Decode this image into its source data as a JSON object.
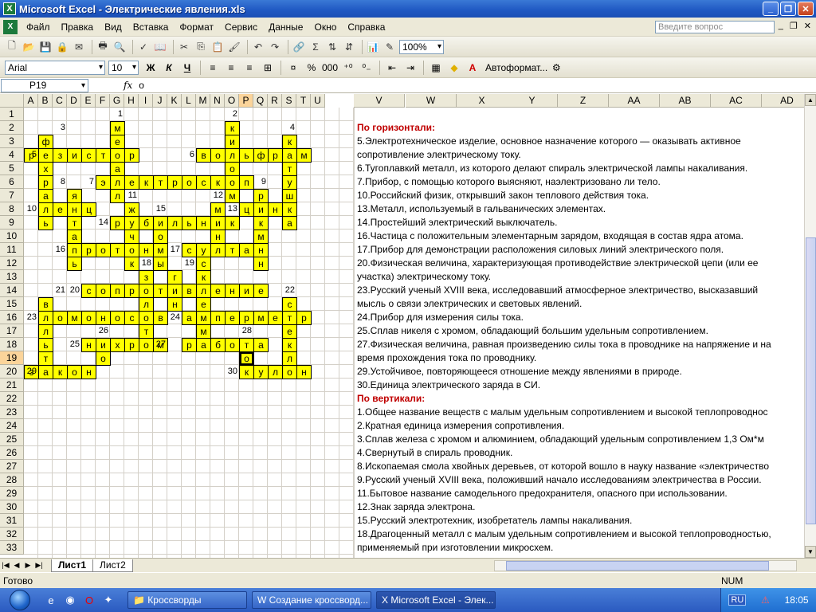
{
  "window": {
    "title": "Microsoft Excel - Электрические явления.xls",
    "app_icon": "X"
  },
  "menu": {
    "items": [
      "Файл",
      "Правка",
      "Вид",
      "Вставка",
      "Формат",
      "Сервис",
      "Данные",
      "Окно",
      "Справка"
    ],
    "ask_placeholder": "Введите вопрос"
  },
  "toolbar": {
    "zoom": "100%",
    "font": "Arial",
    "size": "10",
    "autoformat": "Автоформат..."
  },
  "formula": {
    "cell": "P19",
    "fx": "fx",
    "value": "о"
  },
  "columns": [
    "A",
    "B",
    "C",
    "D",
    "E",
    "F",
    "G",
    "H",
    "I",
    "J",
    "K",
    "L",
    "M",
    "N",
    "O",
    "P",
    "Q",
    "R",
    "S",
    "T",
    "U"
  ],
  "columns_wide": [
    "V",
    "W",
    "X",
    "Y",
    "Z",
    "AA",
    "AB",
    "AC",
    "AD"
  ],
  "rows": [
    "1",
    "2",
    "3",
    "4",
    "5",
    "6",
    "7",
    "8",
    "9",
    "10",
    "11",
    "12",
    "13",
    "14",
    "15",
    "16",
    "17",
    "18",
    "19",
    "20",
    "21",
    "22",
    "23",
    "24",
    "25",
    "26",
    "27",
    "28",
    "29",
    "30",
    "31",
    "32",
    "33"
  ],
  "crossword": {
    "numbers": [
      {
        "t": "1",
        "r": 1,
        "c": 7
      },
      {
        "t": "2",
        "r": 1,
        "c": 15
      },
      {
        "t": "3",
        "r": 2,
        "c": 3
      },
      {
        "t": "4",
        "r": 2,
        "c": 19
      },
      {
        "t": "5",
        "r": 4,
        "c": 1
      },
      {
        "t": "6",
        "r": 4,
        "c": 12
      },
      {
        "t": "8",
        "r": 6,
        "c": 3
      },
      {
        "t": "7",
        "r": 6,
        "c": 5
      },
      {
        "t": "9",
        "r": 6,
        "c": 17
      },
      {
        "t": "11",
        "r": 7,
        "c": 8
      },
      {
        "t": "12",
        "r": 7,
        "c": 14
      },
      {
        "t": "10",
        "r": 8,
        "c": 1
      },
      {
        "t": "15",
        "r": 8,
        "c": 10
      },
      {
        "t": "13",
        "r": 8,
        "c": 15
      },
      {
        "t": "14",
        "r": 9,
        "c": 6
      },
      {
        "t": "16",
        "r": 11,
        "c": 3
      },
      {
        "t": "17",
        "r": 11,
        "c": 11
      },
      {
        "t": "18",
        "r": 12,
        "c": 9
      },
      {
        "t": "19",
        "r": 12,
        "c": 12
      },
      {
        "t": "21",
        "r": 14,
        "c": 3
      },
      {
        "t": "20",
        "r": 14,
        "c": 4
      },
      {
        "t": "22",
        "r": 14,
        "c": 19
      },
      {
        "t": "23",
        "r": 16,
        "c": 1
      },
      {
        "t": "24",
        "r": 16,
        "c": 11
      },
      {
        "t": "26",
        "r": 17,
        "c": 6
      },
      {
        "t": "28",
        "r": 17,
        "c": 16
      },
      {
        "t": "25",
        "r": 18,
        "c": 4
      },
      {
        "t": "27",
        "r": 18,
        "c": 10
      },
      {
        "t": "29",
        "r": 20,
        "c": 1
      },
      {
        "t": "30",
        "r": 20,
        "c": 15
      }
    ],
    "cells": [
      {
        "r": 2,
        "c": 7,
        "ch": "м"
      },
      {
        "r": 2,
        "c": 15,
        "ch": "к"
      },
      {
        "r": 3,
        "c": 2,
        "ch": "ф"
      },
      {
        "r": 3,
        "c": 7,
        "ch": "е"
      },
      {
        "r": 3,
        "c": 15,
        "ch": "и"
      },
      {
        "r": 3,
        "c": 19,
        "ch": "к"
      },
      {
        "r": 4,
        "c": 1,
        "ch": "р"
      },
      {
        "r": 4,
        "c": 2,
        "ch": "е"
      },
      {
        "r": 4,
        "c": 3,
        "ch": "з"
      },
      {
        "r": 4,
        "c": 4,
        "ch": "и"
      },
      {
        "r": 4,
        "c": 5,
        "ch": "с"
      },
      {
        "r": 4,
        "c": 6,
        "ch": "т"
      },
      {
        "r": 4,
        "c": 7,
        "ch": "о"
      },
      {
        "r": 4,
        "c": 8,
        "ch": "р"
      },
      {
        "r": 4,
        "c": 13,
        "ch": "в"
      },
      {
        "r": 4,
        "c": 14,
        "ch": "о"
      },
      {
        "r": 4,
        "c": 15,
        "ch": "л"
      },
      {
        "r": 4,
        "c": 16,
        "ch": "ь"
      },
      {
        "r": 4,
        "c": 17,
        "ch": "ф"
      },
      {
        "r": 4,
        "c": 18,
        "ch": "р"
      },
      {
        "r": 4,
        "c": 19,
        "ch": "а"
      },
      {
        "r": 4,
        "c": 20,
        "ch": "м"
      },
      {
        "r": 5,
        "c": 2,
        "ch": "х"
      },
      {
        "r": 5,
        "c": 7,
        "ch": "а"
      },
      {
        "r": 5,
        "c": 15,
        "ch": "о"
      },
      {
        "r": 5,
        "c": 19,
        "ch": "т"
      },
      {
        "r": 6,
        "c": 2,
        "ch": "р"
      },
      {
        "r": 6,
        "c": 6,
        "ch": "э"
      },
      {
        "r": 6,
        "c": 7,
        "ch": "л"
      },
      {
        "r": 6,
        "c": 8,
        "ch": "е"
      },
      {
        "r": 6,
        "c": 9,
        "ch": "к"
      },
      {
        "r": 6,
        "c": 10,
        "ch": "т"
      },
      {
        "r": 6,
        "c": 11,
        "ch": "р"
      },
      {
        "r": 6,
        "c": 12,
        "ch": "о"
      },
      {
        "r": 6,
        "c": 13,
        "ch": "с"
      },
      {
        "r": 6,
        "c": 14,
        "ch": "к"
      },
      {
        "r": 6,
        "c": 15,
        "ch": "о"
      },
      {
        "r": 6,
        "c": 16,
        "ch": "п"
      },
      {
        "r": 6,
        "c": 19,
        "ch": "у"
      },
      {
        "r": 7,
        "c": 2,
        "ch": "а"
      },
      {
        "r": 7,
        "c": 4,
        "ch": "я"
      },
      {
        "r": 7,
        "c": 7,
        "ch": "л"
      },
      {
        "r": 7,
        "c": 15,
        "ch": "м"
      },
      {
        "r": 7,
        "c": 17,
        "ch": "р"
      },
      {
        "r": 7,
        "c": 19,
        "ch": "ш"
      },
      {
        "r": 8,
        "c": 2,
        "ch": "л"
      },
      {
        "r": 8,
        "c": 3,
        "ch": "е"
      },
      {
        "r": 8,
        "c": 4,
        "ch": "н"
      },
      {
        "r": 8,
        "c": 5,
        "ch": "ц"
      },
      {
        "r": 8,
        "c": 8,
        "ch": "ж"
      },
      {
        "r": 8,
        "c": 14,
        "ch": "м"
      },
      {
        "r": 8,
        "c": 16,
        "ch": "ц"
      },
      {
        "r": 8,
        "c": 17,
        "ch": "и"
      },
      {
        "r": 8,
        "c": 18,
        "ch": "н"
      },
      {
        "r": 8,
        "c": 19,
        "ch": "к"
      },
      {
        "r": 9,
        "c": 2,
        "ch": "ь"
      },
      {
        "r": 9,
        "c": 4,
        "ch": "т"
      },
      {
        "r": 9,
        "c": 7,
        "ch": "р"
      },
      {
        "r": 9,
        "c": 8,
        "ch": "у"
      },
      {
        "r": 9,
        "c": 9,
        "ch": "б"
      },
      {
        "r": 9,
        "c": 10,
        "ch": "и"
      },
      {
        "r": 9,
        "c": 11,
        "ch": "л"
      },
      {
        "r": 9,
        "c": 12,
        "ch": "ь"
      },
      {
        "r": 9,
        "c": 13,
        "ch": "н"
      },
      {
        "r": 9,
        "c": 14,
        "ch": "и"
      },
      {
        "r": 9,
        "c": 15,
        "ch": "к"
      },
      {
        "r": 9,
        "c": 17,
        "ch": "к"
      },
      {
        "r": 9,
        "c": 19,
        "ch": "а"
      },
      {
        "r": 10,
        "c": 4,
        "ch": "а"
      },
      {
        "r": 10,
        "c": 8,
        "ch": "ч"
      },
      {
        "r": 10,
        "c": 10,
        "ch": "о"
      },
      {
        "r": 10,
        "c": 14,
        "ch": "н"
      },
      {
        "r": 10,
        "c": 17,
        "ch": "м"
      },
      {
        "r": 11,
        "c": 4,
        "ch": "п"
      },
      {
        "r": 11,
        "c": 5,
        "ch": "р"
      },
      {
        "r": 11,
        "c": 6,
        "ch": "о"
      },
      {
        "r": 11,
        "c": 7,
        "ch": "т"
      },
      {
        "r": 11,
        "c": 8,
        "ch": "о"
      },
      {
        "r": 11,
        "c": 9,
        "ch": "н"
      },
      {
        "r": 11,
        "c": 10,
        "ch": "м"
      },
      {
        "r": 11,
        "c": 12,
        "ch": "с"
      },
      {
        "r": 11,
        "c": 13,
        "ch": "у"
      },
      {
        "r": 11,
        "c": 14,
        "ch": "л"
      },
      {
        "r": 11,
        "c": 15,
        "ch": "т"
      },
      {
        "r": 11,
        "c": 16,
        "ch": "а"
      },
      {
        "r": 11,
        "c": 17,
        "ch": "н"
      },
      {
        "r": 12,
        "c": 4,
        "ch": "ь"
      },
      {
        "r": 12,
        "c": 8,
        "ch": "к"
      },
      {
        "r": 12,
        "c": 10,
        "ch": "ы"
      },
      {
        "r": 12,
        "c": 13,
        "ch": "с"
      },
      {
        "r": 12,
        "c": 17,
        "ch": "н"
      },
      {
        "r": 13,
        "c": 9,
        "ch": "з"
      },
      {
        "r": 13,
        "c": 11,
        "ch": "г"
      },
      {
        "r": 13,
        "c": 13,
        "ch": "к"
      },
      {
        "r": 14,
        "c": 5,
        "ch": "с"
      },
      {
        "r": 14,
        "c": 6,
        "ch": "о"
      },
      {
        "r": 14,
        "c": 7,
        "ch": "п"
      },
      {
        "r": 14,
        "c": 8,
        "ch": "р"
      },
      {
        "r": 14,
        "c": 9,
        "ch": "о"
      },
      {
        "r": 14,
        "c": 10,
        "ch": "т"
      },
      {
        "r": 14,
        "c": 11,
        "ch": "и"
      },
      {
        "r": 14,
        "c": 12,
        "ch": "в"
      },
      {
        "r": 14,
        "c": 13,
        "ch": "л"
      },
      {
        "r": 14,
        "c": 14,
        "ch": "е"
      },
      {
        "r": 14,
        "c": 15,
        "ch": "н"
      },
      {
        "r": 14,
        "c": 16,
        "ch": "и"
      },
      {
        "r": 14,
        "c": 17,
        "ch": "е"
      },
      {
        "r": 15,
        "c": 2,
        "ch": "в"
      },
      {
        "r": 15,
        "c": 9,
        "ch": "л"
      },
      {
        "r": 15,
        "c": 11,
        "ch": "н"
      },
      {
        "r": 15,
        "c": 13,
        "ch": "е"
      },
      {
        "r": 15,
        "c": 19,
        "ch": "с"
      },
      {
        "r": 16,
        "c": 2,
        "ch": "л"
      },
      {
        "r": 16,
        "c": 3,
        "ch": "о"
      },
      {
        "r": 16,
        "c": 4,
        "ch": "м"
      },
      {
        "r": 16,
        "c": 5,
        "ch": "о"
      },
      {
        "r": 16,
        "c": 6,
        "ch": "н"
      },
      {
        "r": 16,
        "c": 7,
        "ch": "о"
      },
      {
        "r": 16,
        "c": 8,
        "ch": "с"
      },
      {
        "r": 16,
        "c": 9,
        "ch": "о"
      },
      {
        "r": 16,
        "c": 10,
        "ch": "в"
      },
      {
        "r": 16,
        "c": 12,
        "ch": "а"
      },
      {
        "r": 16,
        "c": 13,
        "ch": "м"
      },
      {
        "r": 16,
        "c": 14,
        "ch": "п"
      },
      {
        "r": 16,
        "c": 15,
        "ch": "е"
      },
      {
        "r": 16,
        "c": 16,
        "ch": "р"
      },
      {
        "r": 16,
        "c": 17,
        "ch": "м"
      },
      {
        "r": 16,
        "c": 18,
        "ch": "е"
      },
      {
        "r": 16,
        "c": 19,
        "ch": "т"
      },
      {
        "r": 16,
        "c": 20,
        "ch": "р"
      },
      {
        "r": 17,
        "c": 2,
        "ch": "л"
      },
      {
        "r": 17,
        "c": 9,
        "ch": "т"
      },
      {
        "r": 17,
        "c": 13,
        "ch": "м"
      },
      {
        "r": 17,
        "c": 19,
        "ch": "е"
      },
      {
        "r": 18,
        "c": 2,
        "ch": "ь"
      },
      {
        "r": 18,
        "c": 5,
        "ch": "н"
      },
      {
        "r": 18,
        "c": 6,
        "ch": "и"
      },
      {
        "r": 18,
        "c": 7,
        "ch": "х"
      },
      {
        "r": 18,
        "c": 8,
        "ch": "р"
      },
      {
        "r": 18,
        "c": 9,
        "ch": "о"
      },
      {
        "r": 18,
        "c": 10,
        "ch": "м"
      },
      {
        "r": 18,
        "c": 12,
        "ch": "р"
      },
      {
        "r": 18,
        "c": 13,
        "ch": "а"
      },
      {
        "r": 18,
        "c": 14,
        "ch": "б"
      },
      {
        "r": 18,
        "c": 15,
        "ch": "о"
      },
      {
        "r": 18,
        "c": 16,
        "ch": "т"
      },
      {
        "r": 18,
        "c": 17,
        "ch": "а"
      },
      {
        "r": 18,
        "c": 19,
        "ch": "к"
      },
      {
        "r": 19,
        "c": 2,
        "ch": "т"
      },
      {
        "r": 19,
        "c": 6,
        "ch": "о"
      },
      {
        "r": 19,
        "c": 16,
        "ch": "о",
        "active": true
      },
      {
        "r": 19,
        "c": 19,
        "ch": "л"
      },
      {
        "r": 20,
        "c": 1,
        "ch": "з"
      },
      {
        "r": 20,
        "c": 2,
        "ch": "а"
      },
      {
        "r": 20,
        "c": 3,
        "ch": "к"
      },
      {
        "r": 20,
        "c": 4,
        "ch": "о"
      },
      {
        "r": 20,
        "c": 5,
        "ch": "н"
      },
      {
        "r": 20,
        "c": 16,
        "ch": "к"
      },
      {
        "r": 20,
        "c": 17,
        "ch": "у"
      },
      {
        "r": 20,
        "c": 18,
        "ch": "л"
      },
      {
        "r": 20,
        "c": 19,
        "ch": "о"
      },
      {
        "r": 20,
        "c": 20,
        "ch": "н"
      }
    ]
  },
  "clues": [
    {
      "row": 2,
      "text": "По горизонтали:",
      "head": true
    },
    {
      "row": 3,
      "text": "5.Электротехническое изделие, основное назначение которого — оказывать активное"
    },
    {
      "row": 4,
      "text": "сопротивление электрическому току."
    },
    {
      "row": 5,
      "text": "6.Тугоплавкий металл, из которого делают спираль электрической лампы накаливания."
    },
    {
      "row": 6,
      "text": "7.Прибор, с помощью которого выясняют, наэлектризовано ли тело."
    },
    {
      "row": 7,
      "text": "10.Российский физик, открывший закон теплового действия тока."
    },
    {
      "row": 8,
      "text": "13.Металл, используемый в гальванических элементах."
    },
    {
      "row": 9,
      "text": "14.Простейший электрический выключатель."
    },
    {
      "row": 10,
      "text": "16.Частица с положительным элементарным зарядом, входящая в состав ядра атома."
    },
    {
      "row": 11,
      "text": "17.Прибор для демонстрации расположения силовых линий электрического поля."
    },
    {
      "row": 12,
      "text": "20.Физическая величина, характеризующая противодействие электрической цепи (или ее"
    },
    {
      "row": 13,
      "text": "участка) электрическому току."
    },
    {
      "row": 14,
      "text": "23.Русский ученый XVIII века, исследовавший атмосферное электричество, высказавший"
    },
    {
      "row": 15,
      "text": "мысль о связи электрических и световых явлений."
    },
    {
      "row": 16,
      "text": "24.Прибор для измерения силы тока."
    },
    {
      "row": 17,
      "text": "25.Сплав никеля с хромом, обладающий большим удельным сопротивлением."
    },
    {
      "row": 18,
      "text": "27.Физическая величина, равная произведению силы тока в проводнике на напряжение и на"
    },
    {
      "row": 19,
      "text": "время прохождения тока по проводнику."
    },
    {
      "row": 20,
      "text": "29.Устойчивое, повторяющееся отношение между явлениями в природе."
    },
    {
      "row": 21,
      "text": "30.Единица электрического заряда в СИ."
    },
    {
      "row": 22,
      "text": "По вертикали:",
      "head": true
    },
    {
      "row": 23,
      "text": "1.Общее название веществ с малым удельным сопротивлением и высокой теплопроводнос"
    },
    {
      "row": 24,
      "text": "2.Кратная единица измерения сопротивления."
    },
    {
      "row": 25,
      "text": "3.Сплав железа с хромом и алюминием, обладающий удельным сопротивлением 1,3 Ом*м"
    },
    {
      "row": 26,
      "text": "4.Свернутый в спираль проводник."
    },
    {
      "row": 27,
      "text": "8.Ископаемая смола хвойных деревьев, от которой вошло в науку название «электричество"
    },
    {
      "row": 28,
      "text": "9.Русский ученый XVIII века, положивший начало исследованиям электричества в России."
    },
    {
      "row": 29,
      "text": "11.Бытовое название самодельного предохранителя, опасного при использовании."
    },
    {
      "row": 30,
      "text": "12.Знак заряда электрона."
    },
    {
      "row": 31,
      "text": "15.Русский электротехник, изобретатель лампы накаливания."
    },
    {
      "row": 32,
      "text": "18.Драгоценный металл с малым удельным сопротивлением и высокой теплопроводностью,"
    },
    {
      "row": 33,
      "text": "применяемый при изготовлении микросхем."
    }
  ],
  "sheets": {
    "tabs": [
      "Лист1",
      "Лист2"
    ]
  },
  "status": {
    "ready": "Готово",
    "num": "NUM"
  },
  "taskbar": {
    "tasks": [
      "Кроссворды",
      "Создание кроссворд...",
      "Microsoft Excel - Элек..."
    ],
    "lang": "RU",
    "clock": "18:05"
  }
}
